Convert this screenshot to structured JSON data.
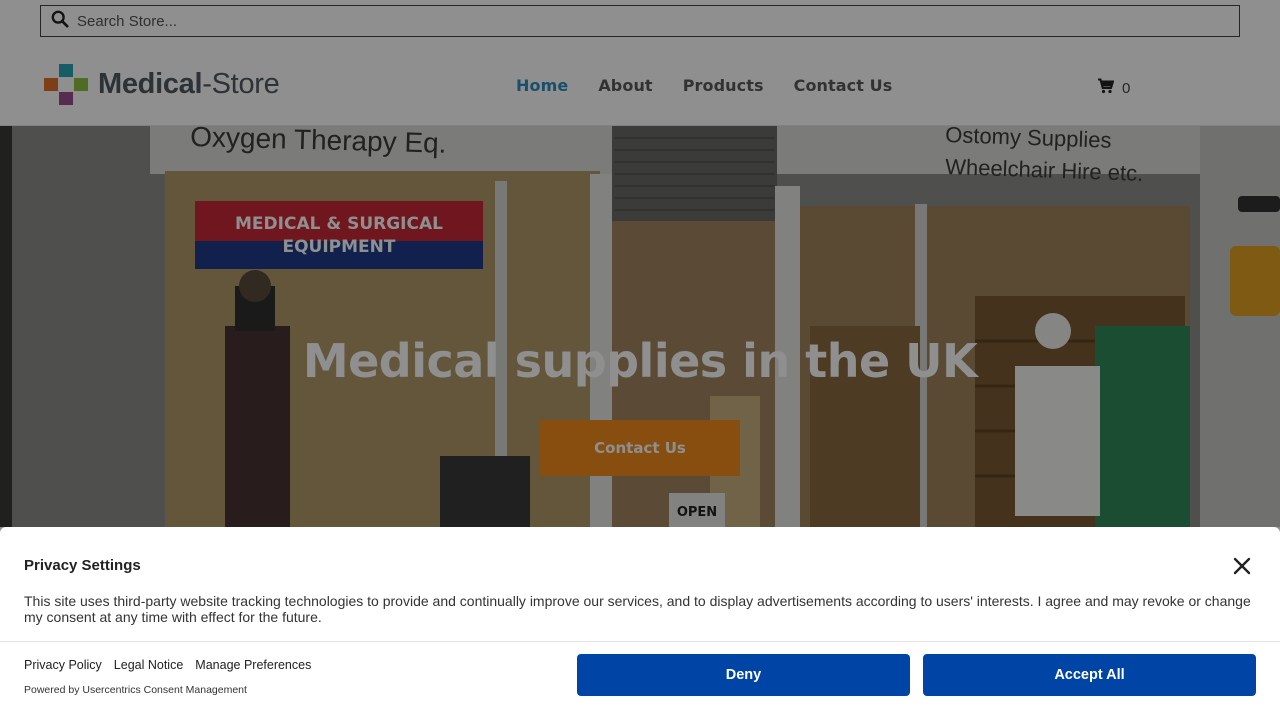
{
  "header": {
    "search_placeholder": "Search Store...",
    "logo": {
      "brand": "Medical",
      "suffix": "-Store"
    },
    "nav": [
      {
        "label": "Home",
        "active": true
      },
      {
        "label": "About",
        "active": false
      },
      {
        "label": "Products",
        "active": false
      },
      {
        "label": "Contact Us",
        "active": false
      }
    ],
    "cart_count": "0",
    "icons": {
      "search": "search-icon",
      "cart": "shopping-cart-icon"
    }
  },
  "hero": {
    "title": "Medical supplies in the UK",
    "button_label": "Contact Us",
    "photo_signage": {
      "sign_left": "Oxygen Therapy Eq.",
      "sign_right_line1": "Ostomy Supplies",
      "sign_right_line2": "Wheelchair Hire etc.",
      "banner_line1": "MEDICAL & SURGICAL",
      "banner_line2": "EQUIPMENT",
      "door_sign": "OPEN"
    }
  },
  "consent": {
    "title": "Privacy Settings",
    "text": "This site uses third-party website tracking technologies to provide and continually improve our services, and to display advertisements according to users' interests. I agree and may revoke or change my consent at any time with effect for the future.",
    "links": [
      "Privacy Policy",
      "Legal Notice",
      "Manage Preferences"
    ],
    "powered_by": "Powered by Usercentrics Consent Management",
    "deny_label": "Deny",
    "accept_label": "Accept All"
  },
  "colors": {
    "accent": "#2c8fbf",
    "hero_button": "#f08c1e",
    "consent_button": "#0045a5",
    "logo_tiles": [
      "#2aa6b8",
      "#8fbf3f",
      "#e0702a",
      "#9b4d8f"
    ]
  }
}
